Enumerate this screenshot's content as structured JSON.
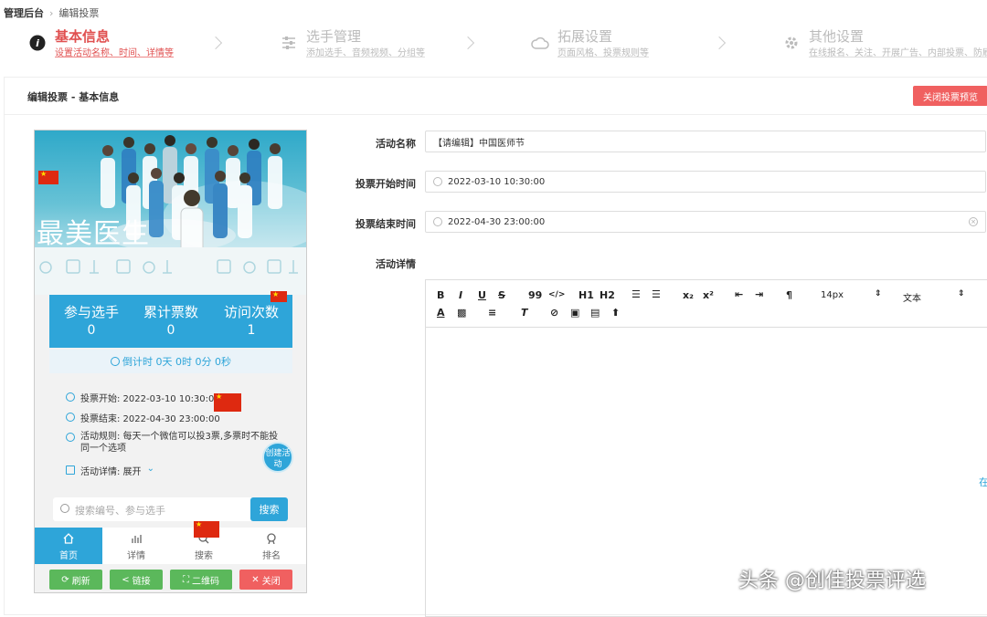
{
  "breadcrumb": {
    "root": "管理后台",
    "current": "编辑投票"
  },
  "steps": [
    {
      "title": "基本信息",
      "subtitle": "设置活动名称、时间、详情等"
    },
    {
      "title": "选手管理",
      "subtitle": "添加选手、音频视频、分组等"
    },
    {
      "title": "拓展设置",
      "subtitle": "页面风格、投票规则等"
    },
    {
      "title": "其他设置",
      "subtitle": "在线报名、关注、开展广告、内部投票、防刷"
    }
  ],
  "panel": {
    "title": "编辑投票 - 基本信息",
    "close_preview": "关闭投票预览"
  },
  "preview": {
    "banner_title": "最美医生",
    "stats": [
      {
        "label": "参与选手",
        "value": "0"
      },
      {
        "label": "累计票数",
        "value": "0"
      },
      {
        "label": "访问次数",
        "value": "1"
      }
    ],
    "countdown": "倒计时 0天 0时 0分 0秒",
    "info": [
      {
        "text": "投票开始: 2022-03-10 10:30:00"
      },
      {
        "text": "投票结束: 2022-04-30 23:00:00"
      },
      {
        "text": "活动规则: 每天一个微信可以投3票,多票时不能投同一个选项"
      },
      {
        "text": "活动详情: 展开"
      }
    ],
    "create_btn": "创建活动",
    "search_placeholder": "搜索编号、参与选手",
    "search_btn": "搜索",
    "tabs": [
      "首页",
      "详情",
      "搜索",
      "排名"
    ],
    "actions": [
      {
        "label": "刷新",
        "color": "#5bb85b"
      },
      {
        "label": "链接",
        "color": "#5bb85b"
      },
      {
        "label": "二维码",
        "color": "#5bb85b"
      },
      {
        "label": "关闭",
        "color": "#f06060"
      }
    ]
  },
  "form": {
    "name_label": "活动名称",
    "name_value": "【请编辑】中国医师节",
    "start_label": "投票开始时间",
    "start_value": "2022-03-10 10:30:00",
    "end_label": "投票结束时间",
    "end_value": "2022-04-30 23:00:00",
    "detail_label": "活动详情"
  },
  "toolbar": {
    "bold": "B",
    "italic": "I",
    "underline": "U",
    "strike": "S",
    "quote": "99",
    "code": "</>",
    "h1": "H1",
    "h2": "H2",
    "sub": "x₂",
    "sup": "x²",
    "font_size": "14px",
    "text_type": "文本"
  },
  "edge_char": "在",
  "watermark": "头条 @创佳投票评选",
  "colors": {
    "accent": "#2ea5d9",
    "danger": "#f06060",
    "active_step": "#e05050",
    "green": "#5bb85b"
  }
}
